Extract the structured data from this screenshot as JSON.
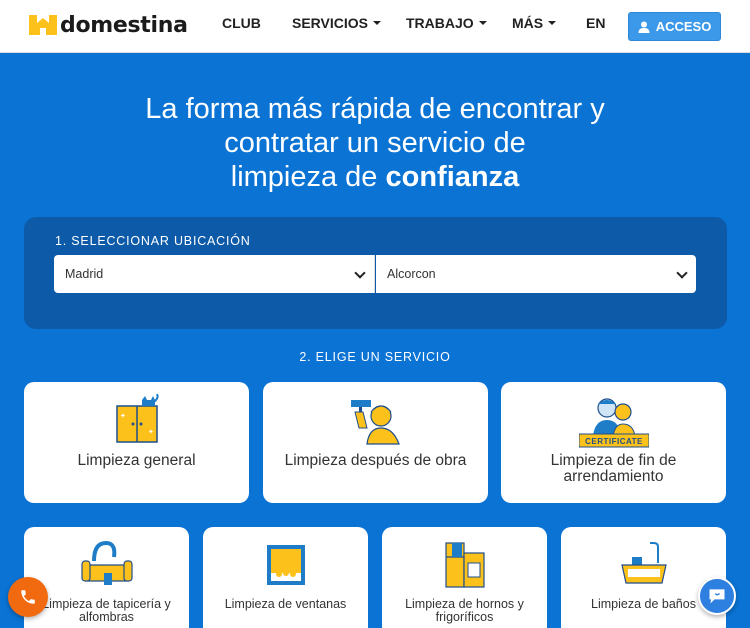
{
  "brand": {
    "name": "Domestina"
  },
  "nav": {
    "club": "CLUB",
    "servicios": "SERVICIOS",
    "trabajo": "TRABAJO",
    "mas": "MÁS",
    "lang": "EN",
    "acceso": "ACCESO"
  },
  "hero": {
    "line1": "La forma más rápida de encontrar y",
    "line2": "contratar un servicio de",
    "line3_normal": "limpieza de ",
    "line3_bold": "confianza"
  },
  "location": {
    "label": "1. SELECCIONAR UBICACIÓN",
    "province": "Madrid",
    "city": "Alcorcon"
  },
  "services": {
    "label": "2. ELIGE UN SERVICIO",
    "featured": [
      {
        "label": "Limpieza general",
        "icon": "cabinet-cat-icon"
      },
      {
        "label": "Limpieza después de obra",
        "icon": "worker-paint-roller-icon"
      },
      {
        "label": "Limpieza de fin de arrendamiento",
        "icon": "cleaners-certificate-icon",
        "badge": "CERTIFICATE"
      }
    ],
    "others": [
      {
        "label": "Limpieza de tapicería y alfombras",
        "icon": "sofa-vacuum-icon"
      },
      {
        "label": "Limpieza de ventanas",
        "icon": "window-icon"
      },
      {
        "label": "Limpieza de hornos y frigoríficos",
        "icon": "fridge-oven-icon"
      },
      {
        "label": "Limpieza de baños",
        "icon": "bathtub-icon"
      }
    ]
  },
  "colors": {
    "background": "#0a73d4",
    "panel": "#0d5aa8",
    "accent_yellow": "#fcc21b",
    "button_blue": "#3c98e8",
    "phone_orange": "#f26a10"
  },
  "floating": {
    "phone_icon": "phone-icon",
    "chat_icon": "chat-icon"
  }
}
